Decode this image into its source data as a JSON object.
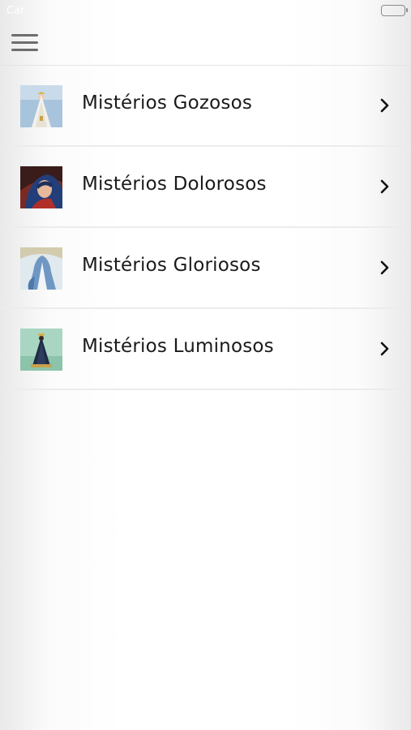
{
  "status_bar": {
    "carrier": "Car",
    "battery_icon": "battery-icon"
  },
  "nav": {
    "menu_icon": "hamburger-menu-icon"
  },
  "mysteries": [
    {
      "label": "Mistérios Gozosos",
      "thumbnail": "our-lady-of-fatima-image",
      "chevron_icon": "chevron-right-icon"
    },
    {
      "label": "Mistérios Dolorosos",
      "thumbnail": "sorrowful-mother-image",
      "chevron_icon": "chevron-right-icon"
    },
    {
      "label": "Mistérios Gloriosos",
      "thumbnail": "our-lady-of-grace-image",
      "chevron_icon": "chevron-right-icon"
    },
    {
      "label": "Mistérios Luminosos",
      "thumbnail": "our-lady-aparecida-image",
      "chevron_icon": "chevron-right-icon"
    }
  ],
  "colors": {
    "text": "#1a1a1a",
    "menu_icon": "#6d6d6d",
    "divider": "#ececec",
    "background": "#ffffff"
  }
}
